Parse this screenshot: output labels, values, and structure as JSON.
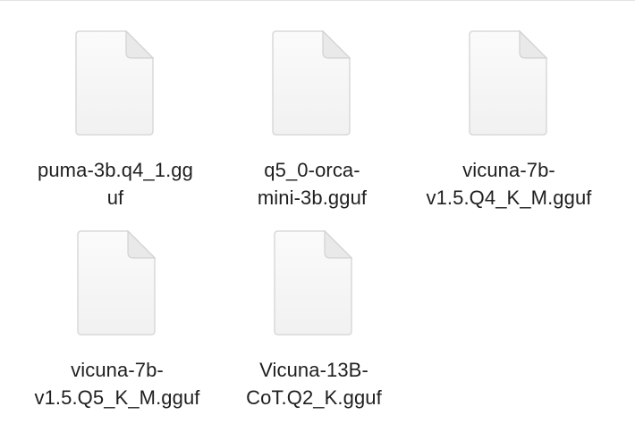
{
  "window": {
    "view": "icon-view"
  },
  "files": [
    {
      "name_display": "puma-3b.q4_1.gg\nuf",
      "icon": "document-icon"
    },
    {
      "name_display": "q5_0-orca-\nmini-3b.gguf",
      "icon": "document-icon"
    },
    {
      "name_display": "vicuna-7b-\nv1.5.Q4_K_M.gguf",
      "icon": "document-icon"
    },
    {
      "name_display": "vicuna-7b-\nv1.5.Q5_K_M.gguf",
      "icon": "document-icon"
    },
    {
      "name_display": "Vicuna-13B-\nCoT.Q2_K.gguf",
      "icon": "document-icon"
    }
  ]
}
